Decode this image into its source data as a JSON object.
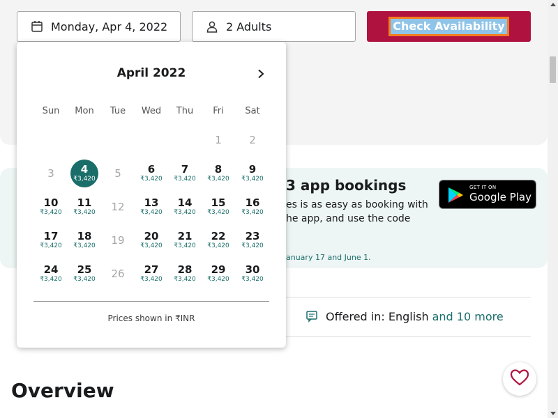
{
  "search": {
    "date_value": "Monday, Apr 4, 2022",
    "guests_value": "2 Adults",
    "cta_label": "Check Availability"
  },
  "calendar": {
    "month_title": "April 2022",
    "weekdays": [
      "Sun",
      "Mon",
      "Tue",
      "Wed",
      "Thu",
      "Fri",
      "Sat"
    ],
    "selected_day": "4",
    "weeks": [
      [
        {
          "day": "",
          "price": "",
          "enabled": false
        },
        {
          "day": "",
          "price": "",
          "enabled": false
        },
        {
          "day": "",
          "price": "",
          "enabled": false
        },
        {
          "day": "",
          "price": "",
          "enabled": false
        },
        {
          "day": "",
          "price": "",
          "enabled": false
        },
        {
          "day": "1",
          "price": "",
          "enabled": false
        },
        {
          "day": "2",
          "price": "",
          "enabled": false
        }
      ],
      [
        {
          "day": "3",
          "price": "",
          "enabled": false
        },
        {
          "day": "4",
          "price": "₹3,420",
          "enabled": true
        },
        {
          "day": "5",
          "price": "",
          "enabled": false
        },
        {
          "day": "6",
          "price": "₹3,420",
          "enabled": true
        },
        {
          "day": "7",
          "price": "₹3,420",
          "enabled": true
        },
        {
          "day": "8",
          "price": "₹3,420",
          "enabled": true
        },
        {
          "day": "9",
          "price": "₹3,420",
          "enabled": true
        }
      ],
      [
        {
          "day": "10",
          "price": "₹3,420",
          "enabled": true
        },
        {
          "day": "11",
          "price": "₹3,420",
          "enabled": true
        },
        {
          "day": "12",
          "price": "",
          "enabled": false
        },
        {
          "day": "13",
          "price": "₹3,420",
          "enabled": true
        },
        {
          "day": "14",
          "price": "₹3,420",
          "enabled": true
        },
        {
          "day": "15",
          "price": "₹3,420",
          "enabled": true
        },
        {
          "day": "16",
          "price": "₹3,420",
          "enabled": true
        }
      ],
      [
        {
          "day": "17",
          "price": "₹3,420",
          "enabled": true
        },
        {
          "day": "18",
          "price": "₹3,420",
          "enabled": true
        },
        {
          "day": "19",
          "price": "",
          "enabled": false
        },
        {
          "day": "20",
          "price": "₹3,420",
          "enabled": true
        },
        {
          "day": "21",
          "price": "₹3,420",
          "enabled": true
        },
        {
          "day": "22",
          "price": "₹3,420",
          "enabled": true
        },
        {
          "day": "23",
          "price": "₹3,420",
          "enabled": true
        }
      ],
      [
        {
          "day": "24",
          "price": "₹3,420",
          "enabled": true
        },
        {
          "day": "25",
          "price": "₹3,420",
          "enabled": true
        },
        {
          "day": "26",
          "price": "",
          "enabled": false
        },
        {
          "day": "27",
          "price": "₹3,420",
          "enabled": true
        },
        {
          "day": "28",
          "price": "₹3,420",
          "enabled": true
        },
        {
          "day": "29",
          "price": "₹3,420",
          "enabled": true
        },
        {
          "day": "30",
          "price": "₹3,420",
          "enabled": true
        }
      ]
    ],
    "footer_note": "Prices shown in ₹INR"
  },
  "promo": {
    "title_fragment": "3 app bookings",
    "body_fragment": "es is as easy as booking with he app, and use the code",
    "fine_print_fragment": "anuary 17 and June 1.",
    "store_badge_top": "GET IT ON",
    "store_badge_name": "Google Play"
  },
  "info": {
    "clipped_value": "0",
    "offered_label": "Offered in: English",
    "offered_more": "and 10 more"
  },
  "overview_heading": "Overview",
  "colors": {
    "brand_red": "#b0123f",
    "accent_teal": "#1a6e6a",
    "focus_orange": "#f57c1f"
  },
  "icons": {
    "date_field": "calendar-icon",
    "guest_field": "person-icon",
    "next_month": "chevron-right-icon",
    "language": "chat-bubble-icon",
    "favorite": "heart-icon"
  }
}
